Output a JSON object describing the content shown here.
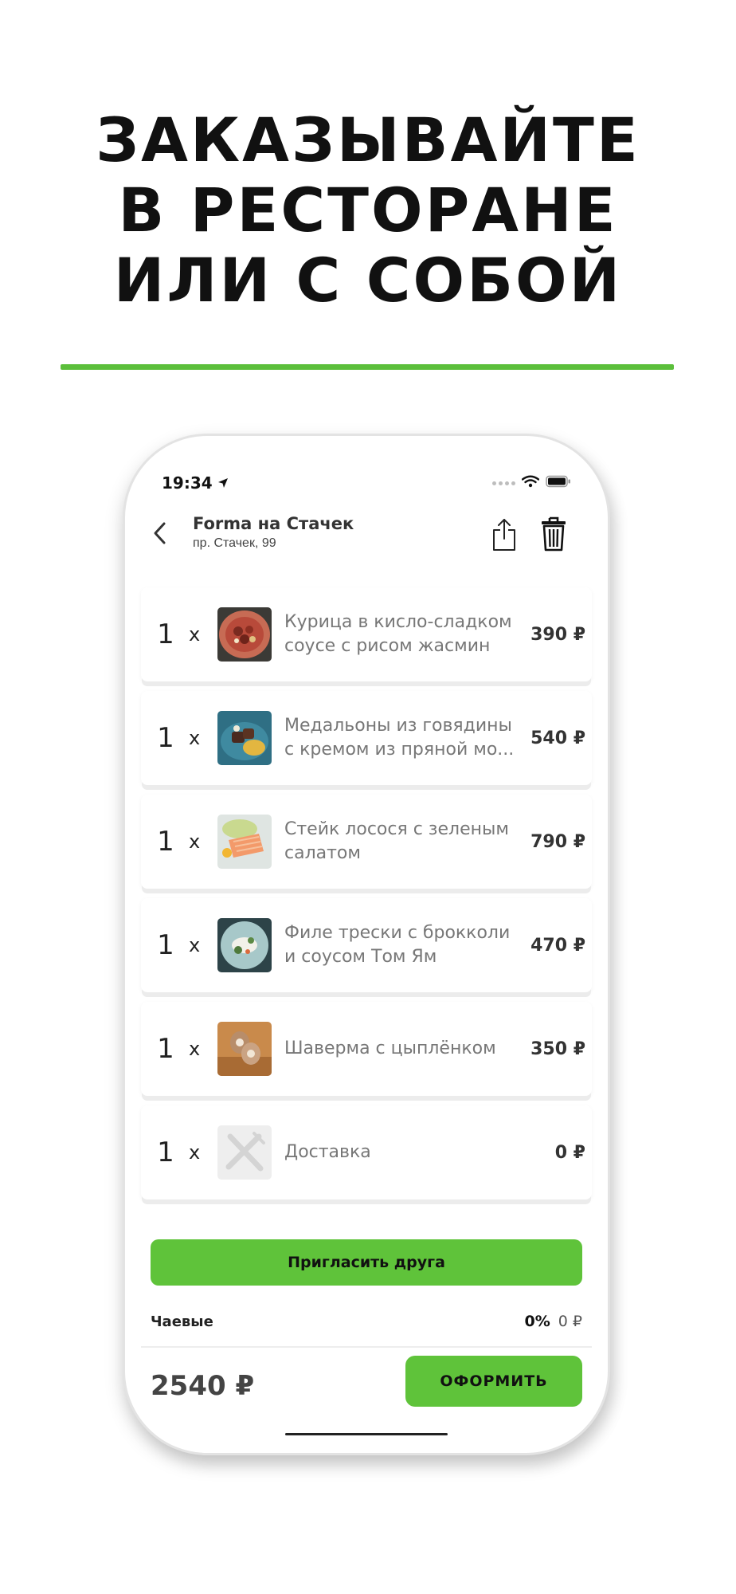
{
  "headline": {
    "lines": [
      "ЗАКАЗЫВАЙТЕ",
      "В РЕСТОРАНЕ",
      "ИЛИ С СОБОЙ"
    ]
  },
  "colors": {
    "accent": "#5fc33a",
    "rule": "#5bbf3b"
  },
  "status_bar": {
    "time": "19:34",
    "icons": [
      "location-arrow-icon",
      "signal-icon",
      "wifi-icon",
      "battery-icon"
    ]
  },
  "header": {
    "title": "Forma на Стачек",
    "subtitle": "пр. Стачек, 99",
    "icons": [
      "back-chevron-icon",
      "share-icon",
      "trash-icon"
    ]
  },
  "order_items": [
    {
      "qty": "1",
      "x": "x",
      "name": "Курица в кисло-сладком соусе с рисом жасмин",
      "price": "390 ₽",
      "thumb": "chicken-dish"
    },
    {
      "qty": "1",
      "x": "x",
      "name": "Медальоны из говядины с кремом из пряной мо...",
      "price": "540 ₽",
      "thumb": "beef-medallions"
    },
    {
      "qty": "1",
      "x": "x",
      "name": "Стейк лосося с зеленым салатом",
      "price": "790 ₽",
      "thumb": "salmon-steak"
    },
    {
      "qty": "1",
      "x": "x",
      "name": "Филе трески с брокколи и соусом Том Ям",
      "price": "470 ₽",
      "thumb": "cod-fillet"
    },
    {
      "qty": "1",
      "x": "x",
      "name": "Шаверма с цыплёнком",
      "price": "350 ₽",
      "thumb": "chicken-shawarma"
    },
    {
      "qty": "1",
      "x": "x",
      "name": "Доставка",
      "price": "0 ₽",
      "thumb": "cutlery-placeholder"
    }
  ],
  "invite_button": {
    "label": "Пригласить друга"
  },
  "tips": {
    "label": "Чаевые",
    "percent": "0%",
    "amount": "0 ₽"
  },
  "total": "2540 ₽",
  "checkout_button": {
    "label": "ОФОРМИТЬ"
  }
}
